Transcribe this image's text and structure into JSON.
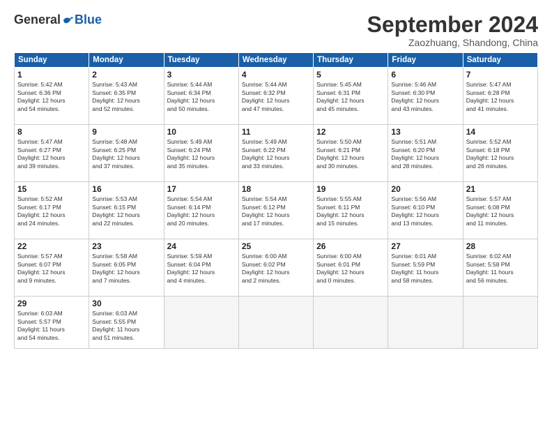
{
  "header": {
    "logo_general": "General",
    "logo_blue": "Blue",
    "month": "September 2024",
    "location": "Zaozhuang, Shandong, China"
  },
  "days_of_week": [
    "Sunday",
    "Monday",
    "Tuesday",
    "Wednesday",
    "Thursday",
    "Friday",
    "Saturday"
  ],
  "weeks": [
    [
      {
        "day": 1,
        "sunrise": "5:42 AM",
        "sunset": "6:36 PM",
        "daylight": "12 hours and 54 minutes."
      },
      {
        "day": 2,
        "sunrise": "5:43 AM",
        "sunset": "6:35 PM",
        "daylight": "12 hours and 52 minutes."
      },
      {
        "day": 3,
        "sunrise": "5:44 AM",
        "sunset": "6:34 PM",
        "daylight": "12 hours and 50 minutes."
      },
      {
        "day": 4,
        "sunrise": "5:44 AM",
        "sunset": "6:32 PM",
        "daylight": "12 hours and 47 minutes."
      },
      {
        "day": 5,
        "sunrise": "5:45 AM",
        "sunset": "6:31 PM",
        "daylight": "12 hours and 45 minutes."
      },
      {
        "day": 6,
        "sunrise": "5:46 AM",
        "sunset": "6:30 PM",
        "daylight": "12 hours and 43 minutes."
      },
      {
        "day": 7,
        "sunrise": "5:47 AM",
        "sunset": "6:28 PM",
        "daylight": "12 hours and 41 minutes."
      }
    ],
    [
      {
        "day": 8,
        "sunrise": "5:47 AM",
        "sunset": "6:27 PM",
        "daylight": "12 hours and 39 minutes."
      },
      {
        "day": 9,
        "sunrise": "5:48 AM",
        "sunset": "6:25 PM",
        "daylight": "12 hours and 37 minutes."
      },
      {
        "day": 10,
        "sunrise": "5:49 AM",
        "sunset": "6:24 PM",
        "daylight": "12 hours and 35 minutes."
      },
      {
        "day": 11,
        "sunrise": "5:49 AM",
        "sunset": "6:22 PM",
        "daylight": "12 hours and 33 minutes."
      },
      {
        "day": 12,
        "sunrise": "5:50 AM",
        "sunset": "6:21 PM",
        "daylight": "12 hours and 30 minutes."
      },
      {
        "day": 13,
        "sunrise": "5:51 AM",
        "sunset": "6:20 PM",
        "daylight": "12 hours and 28 minutes."
      },
      {
        "day": 14,
        "sunrise": "5:52 AM",
        "sunset": "6:18 PM",
        "daylight": "12 hours and 26 minutes."
      }
    ],
    [
      {
        "day": 15,
        "sunrise": "5:52 AM",
        "sunset": "6:17 PM",
        "daylight": "12 hours and 24 minutes."
      },
      {
        "day": 16,
        "sunrise": "5:53 AM",
        "sunset": "6:15 PM",
        "daylight": "12 hours and 22 minutes."
      },
      {
        "day": 17,
        "sunrise": "5:54 AM",
        "sunset": "6:14 PM",
        "daylight": "12 hours and 20 minutes."
      },
      {
        "day": 18,
        "sunrise": "5:54 AM",
        "sunset": "6:12 PM",
        "daylight": "12 hours and 17 minutes."
      },
      {
        "day": 19,
        "sunrise": "5:55 AM",
        "sunset": "6:11 PM",
        "daylight": "12 hours and 15 minutes."
      },
      {
        "day": 20,
        "sunrise": "5:56 AM",
        "sunset": "6:10 PM",
        "daylight": "12 hours and 13 minutes."
      },
      {
        "day": 21,
        "sunrise": "5:57 AM",
        "sunset": "6:08 PM",
        "daylight": "12 hours and 11 minutes."
      }
    ],
    [
      {
        "day": 22,
        "sunrise": "5:57 AM",
        "sunset": "6:07 PM",
        "daylight": "12 hours and 9 minutes."
      },
      {
        "day": 23,
        "sunrise": "5:58 AM",
        "sunset": "6:05 PM",
        "daylight": "12 hours and 7 minutes."
      },
      {
        "day": 24,
        "sunrise": "5:59 AM",
        "sunset": "6:04 PM",
        "daylight": "12 hours and 4 minutes."
      },
      {
        "day": 25,
        "sunrise": "6:00 AM",
        "sunset": "6:02 PM",
        "daylight": "12 hours and 2 minutes."
      },
      {
        "day": 26,
        "sunrise": "6:00 AM",
        "sunset": "6:01 PM",
        "daylight": "12 hours and 0 minutes."
      },
      {
        "day": 27,
        "sunrise": "6:01 AM",
        "sunset": "5:59 PM",
        "daylight": "11 hours and 58 minutes."
      },
      {
        "day": 28,
        "sunrise": "6:02 AM",
        "sunset": "5:58 PM",
        "daylight": "11 hours and 56 minutes."
      }
    ],
    [
      {
        "day": 29,
        "sunrise": "6:03 AM",
        "sunset": "5:57 PM",
        "daylight": "11 hours and 54 minutes."
      },
      {
        "day": 30,
        "sunrise": "6:03 AM",
        "sunset": "5:55 PM",
        "daylight": "11 hours and 51 minutes."
      },
      null,
      null,
      null,
      null,
      null
    ]
  ]
}
